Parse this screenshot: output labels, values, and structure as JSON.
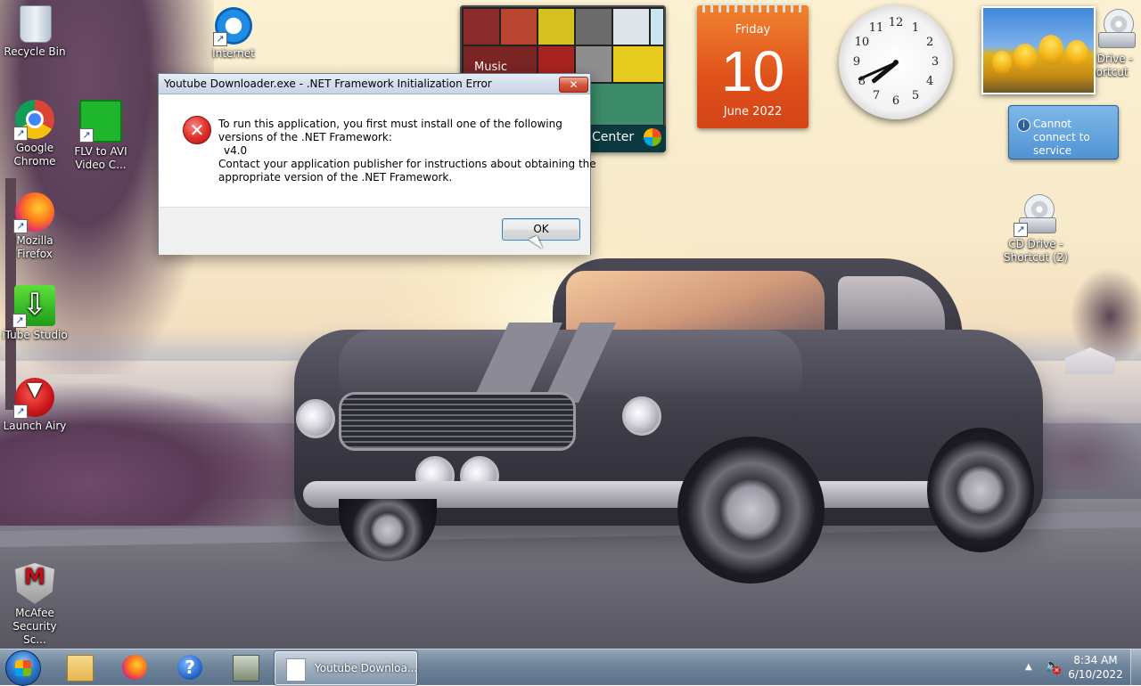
{
  "desktop": {
    "icons": [
      {
        "label": "Recycle Bin"
      },
      {
        "label": "Internet Explorer"
      },
      {
        "label": "Google Chrome"
      },
      {
        "label": "FLV to AVI Video C..."
      },
      {
        "label": "Mozilla Firefox"
      },
      {
        "label": "iTube Studio"
      },
      {
        "label": "Launch Airy"
      },
      {
        "label": "McAfee Security Sc..."
      },
      {
        "label": "CD Drive - Shortcut"
      },
      {
        "label": "CD Drive - Shortcut (2)"
      }
    ]
  },
  "gadgets": {
    "media_center": {
      "label": "Music",
      "footer": "Center"
    },
    "calendar": {
      "weekday": "Friday",
      "day": "10",
      "month_year": "June 2022"
    },
    "clock": {
      "numbers": [
        "12",
        "1",
        "2",
        "3",
        "4",
        "5",
        "6",
        "7",
        "8",
        "9",
        "10",
        "11"
      ],
      "hour": 7,
      "minute": 41
    },
    "feed": {
      "text": "Cannot connect to service"
    }
  },
  "dialog": {
    "title": "Youtube Downloader.exe - .NET Framework Initialization Error",
    "close_label": "✕",
    "message": [
      "To run this application, you first must install one of the following",
      "versions of the .NET Framework:",
      "v4.0",
      "Contact your application publisher for instructions about obtaining the",
      "appropriate version of the .NET Framework."
    ],
    "ok_label": "OK"
  },
  "taskbar": {
    "task_label": "Youtube Downloa...",
    "tray_arrow": "▲",
    "time": "8:34 AM",
    "date": "6/10/2022"
  },
  "colors": {
    "calendar": "#e0501b",
    "dialog_close": "#c23b20",
    "error_icon": "#e0332c",
    "ok_border": "#3c7fb1",
    "feed": "#4f93d4"
  }
}
